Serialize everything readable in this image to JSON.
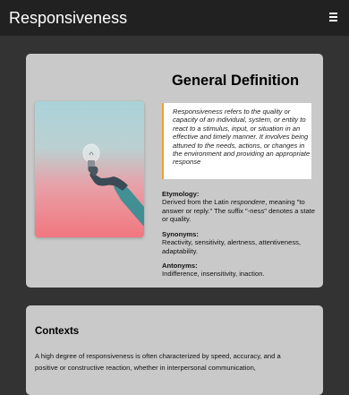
{
  "navbar": {
    "brand": "Responsiveness",
    "menu_icon": "hamburger-menu-icon"
  },
  "definition": {
    "title": "General Definition",
    "image": {
      "description_icon": "lightbulb-photo"
    },
    "quote": "Responsiveness refers to the quality or capacity of an individual, system, or entity to react to a stimulus, input, or situation in an effective and timely manner. It involves being attuned to the needs, actions, or changes in the environment and providing an appropriate response",
    "etymology": {
      "label": "Etymology:",
      "text_before": "Derived from the Latin ",
      "latin": "respondere",
      "text_after": ", meaning \"to answer or reply.\" The suffix \"-ness\" denotes a state or quality."
    },
    "synonyms": {
      "label": "Synonyms:",
      "text": "Reactivity, sensitivity, alertness, attentiveness, adaptability."
    },
    "antonyms": {
      "label": "Antonyms:",
      "text": "Indifference, insensitivity, inaction."
    }
  },
  "contexts": {
    "title": "Contexts",
    "body": "A high degree of responsiveness is often characterized by speed, accuracy, and a positive or constructive reaction, whether in interpersonal communication,"
  },
  "colors": {
    "navbar_bg": "#212121",
    "page_bg": "#333333",
    "card_bg": "#c9c9c9",
    "quote_accent": "#f0a030"
  }
}
